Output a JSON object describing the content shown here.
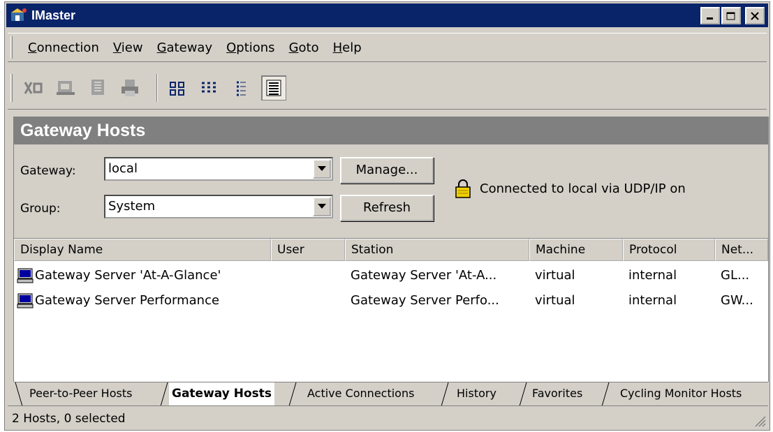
{
  "window": {
    "title": "IMaster"
  },
  "menu": [
    "Connection",
    "View",
    "Gateway",
    "Options",
    "Goto",
    "Help"
  ],
  "toolbar": {
    "buttons": [
      "connect-icon",
      "host-card-icon",
      "host-card-alt-icon",
      "print-icon",
      "large-icons-view-icon",
      "small-icons-view-icon",
      "list-view-icon",
      "details-view-icon"
    ]
  },
  "panel": {
    "title": "Gateway Hosts",
    "gateway_label": "Gateway:",
    "gateway_value": "local",
    "group_label": "Group:",
    "group_value": "System",
    "manage_label": "Manage...",
    "refresh_label": "Refresh",
    "status": "Connected to local via UDP/IP on"
  },
  "table": {
    "columns": [
      "Display Name",
      "User",
      "Station",
      "Machine",
      "Protocol",
      "Net..."
    ],
    "rows": [
      {
        "name": "Gateway Server 'At-A-Glance'",
        "user": "",
        "station": "Gateway Server 'At-A...",
        "machine": "virtual",
        "protocol": "internal",
        "net": "GL..."
      },
      {
        "name": "Gateway Server Performance",
        "user": "",
        "station": "Gateway Server Perfo...",
        "machine": "virtual",
        "protocol": "internal",
        "net": "GW..."
      }
    ]
  },
  "tabs": [
    "Peer-to-Peer Hosts",
    "Gateway Hosts",
    "Active Connections",
    "History",
    "Favorites",
    "Cycling Monitor Hosts"
  ],
  "active_tab": "Gateway Hosts",
  "statusbar": "2 Hosts, 0 selected"
}
